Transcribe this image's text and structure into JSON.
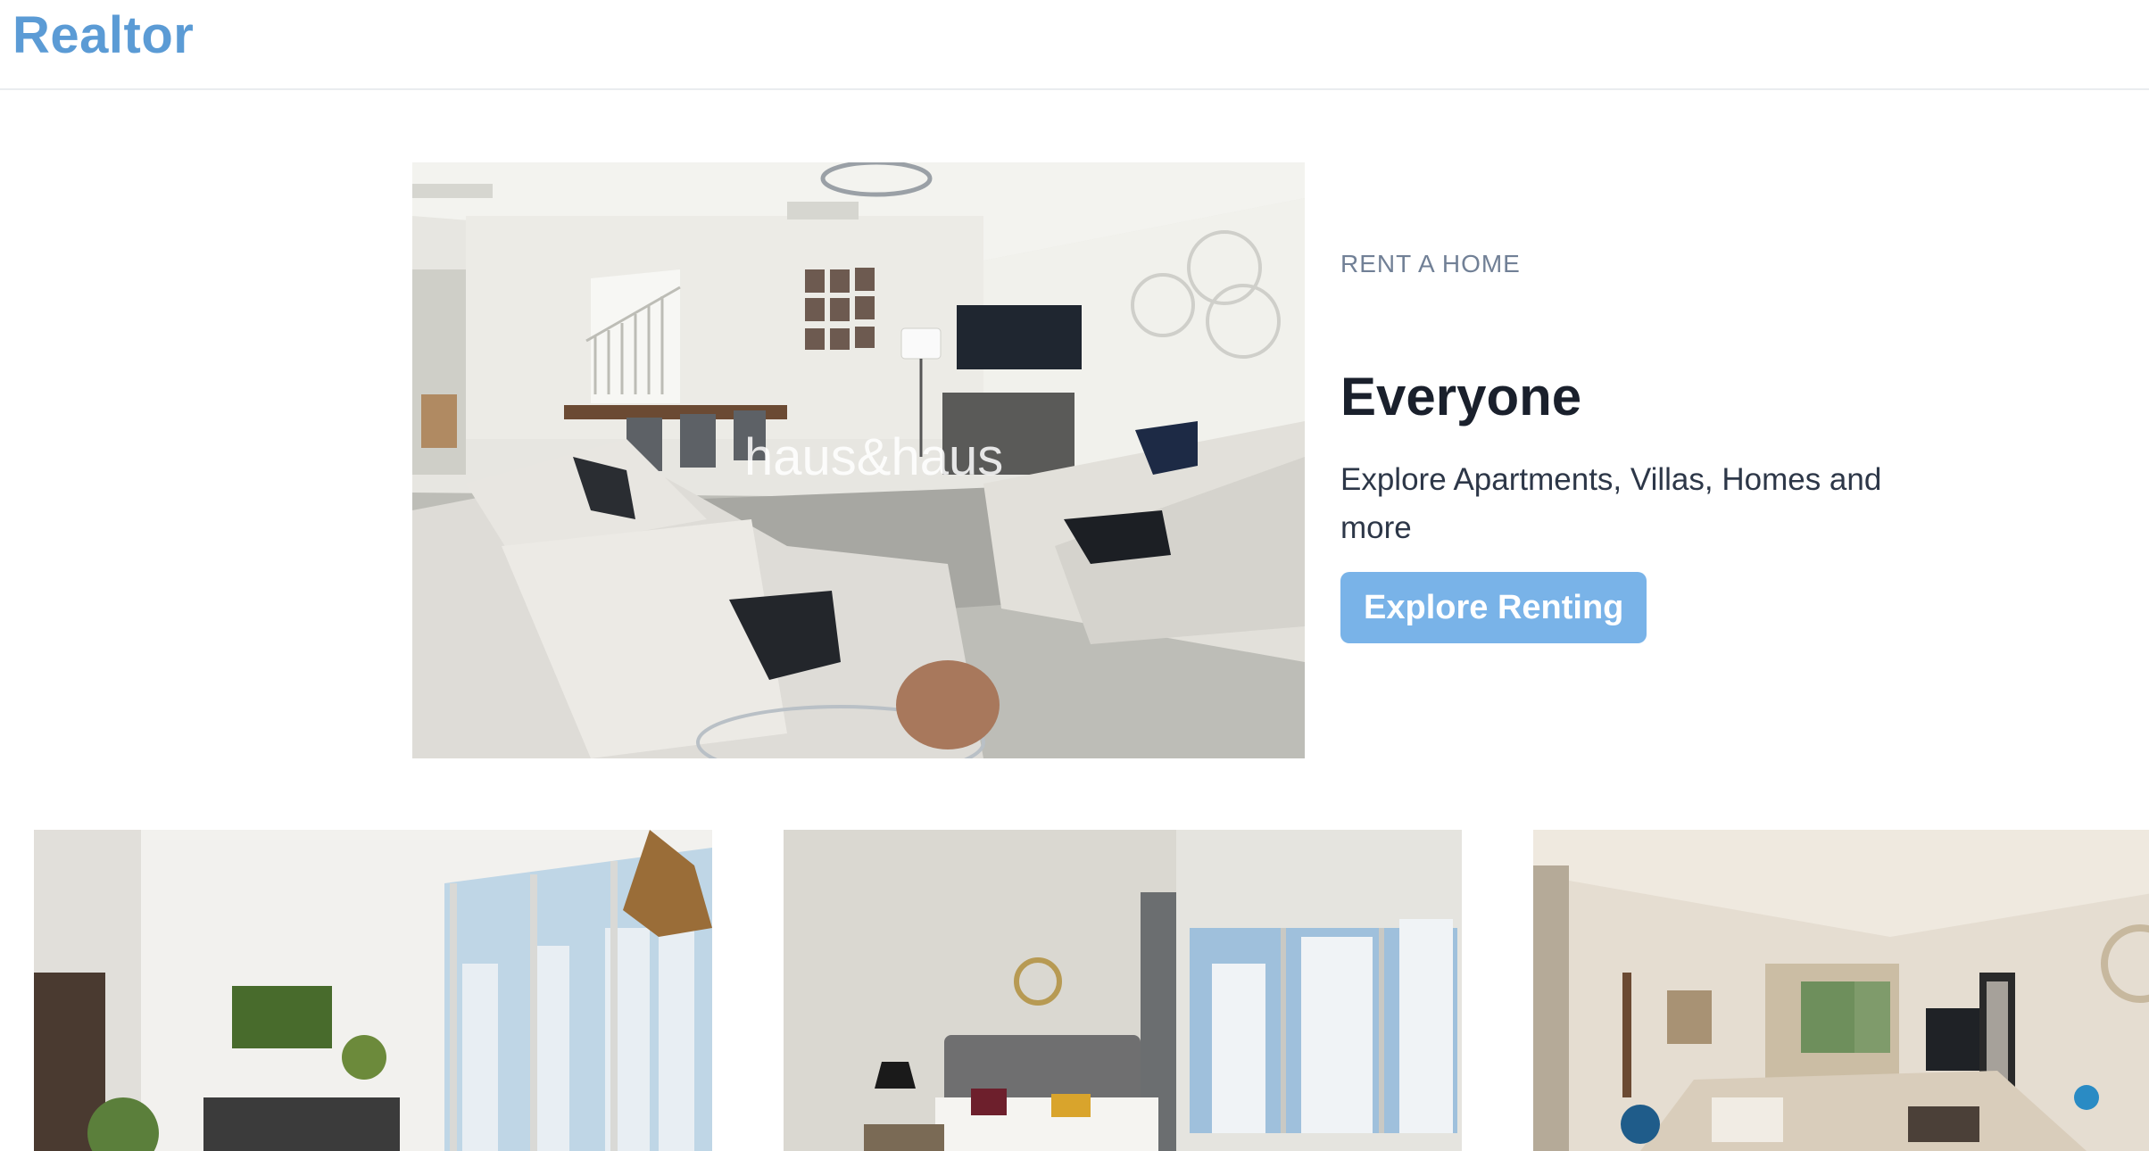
{
  "brand": {
    "name": "Realtor"
  },
  "hero": {
    "eyebrow": "RENT A HOME",
    "heading": "Everyone",
    "subtext": "Explore Apartments, Villas, Homes and more",
    "cta_label": "Explore Renting",
    "image_alt": "Living room with grey sectional sofa",
    "watermark": "haus&haus"
  },
  "listings": [
    {
      "image_alt": "Dining room with pendant light and city view"
    },
    {
      "image_alt": "Bedroom with upholstered headboard and window"
    },
    {
      "image_alt": "Open-plan living room with balcony"
    }
  ],
  "colors": {
    "brand": "#5b9bd5",
    "cta_bg": "#79b3e8",
    "eyebrow": "#718096",
    "heading": "#1a202c"
  }
}
